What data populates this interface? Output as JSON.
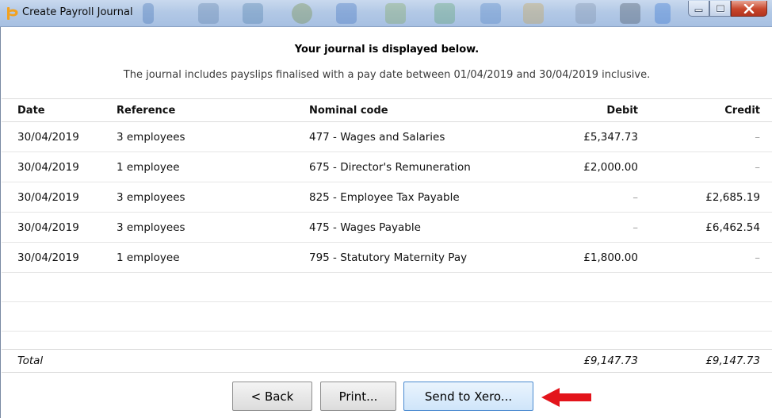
{
  "window": {
    "title": "Create Payroll Journal"
  },
  "heading": "Your journal is displayed below.",
  "subheading": "The journal includes payslips finalised with a pay date between 01/04/2019 and 30/04/2019 inclusive.",
  "columns": {
    "date": "Date",
    "reference": "Reference",
    "nominal": "Nominal code",
    "debit": "Debit",
    "credit": "Credit"
  },
  "rows": [
    {
      "date": "30/04/2019",
      "reference": "3 employees",
      "nominal": "477 - Wages and Salaries",
      "debit": "£5,347.73",
      "credit": "–"
    },
    {
      "date": "30/04/2019",
      "reference": "1 employee",
      "nominal": "675 - Director's Remuneration",
      "debit": "£2,000.00",
      "credit": "–"
    },
    {
      "date": "30/04/2019",
      "reference": "3 employees",
      "nominal": "825 - Employee Tax Payable",
      "debit": "–",
      "credit": "£2,685.19"
    },
    {
      "date": "30/04/2019",
      "reference": "3 employees",
      "nominal": "475 - Wages Payable",
      "debit": "–",
      "credit": "£6,462.54"
    },
    {
      "date": "30/04/2019",
      "reference": "1 employee",
      "nominal": "795 - Statutory Maternity Pay",
      "debit": "£1,800.00",
      "credit": "–"
    }
  ],
  "total": {
    "label": "Total",
    "debit": "£9,147.73",
    "credit": "£9,147.73"
  },
  "buttons": {
    "back": "< Back",
    "print": "Print...",
    "send": "Send to Xero..."
  },
  "colors": {
    "logo": "#f2a11f",
    "arrow": "#e3141b",
    "primary_button_border": "#4a8ad0"
  },
  "icons": {
    "logo": "brightpay-logo-icon",
    "minimize": "minimize-icon",
    "maximize": "maximize-icon",
    "close": "close-icon",
    "pointer": "red-arrow-icon"
  }
}
